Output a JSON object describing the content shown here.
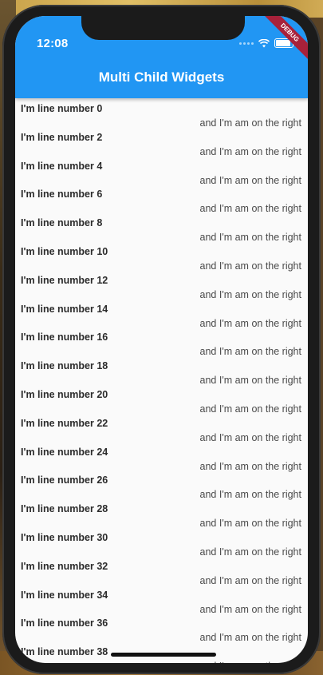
{
  "status_bar": {
    "time": "12:08"
  },
  "banner": {
    "label": "DEBUG"
  },
  "app_bar": {
    "title": "Multi Child Widgets"
  },
  "list": {
    "rows": [
      {
        "left": "I'm line number 0",
        "right": "and I'm am on the right"
      },
      {
        "left": "I'm line number 2",
        "right": "and I'm am on the right"
      },
      {
        "left": "I'm line number 4",
        "right": "and I'm am on the right"
      },
      {
        "left": "I'm line number 6",
        "right": "and I'm am on the right"
      },
      {
        "left": "I'm line number 8",
        "right": "and I'm am on the right"
      },
      {
        "left": "I'm line number 10",
        "right": "and I'm am on the right"
      },
      {
        "left": "I'm line number 12",
        "right": "and I'm am on the right"
      },
      {
        "left": "I'm line number 14",
        "right": "and I'm am on the right"
      },
      {
        "left": "I'm line number 16",
        "right": "and I'm am on the right"
      },
      {
        "left": "I'm line number 18",
        "right": "and I'm am on the right"
      },
      {
        "left": "I'm line number 20",
        "right": "and I'm am on the right"
      },
      {
        "left": "I'm line number 22",
        "right": "and I'm am on the right"
      },
      {
        "left": "I'm line number 24",
        "right": "and I'm am on the right"
      },
      {
        "left": "I'm line number 26",
        "right": "and I'm am on the right"
      },
      {
        "left": "I'm line number 28",
        "right": "and I'm am on the right"
      },
      {
        "left": "I'm line number 30",
        "right": "and I'm am on the right"
      },
      {
        "left": "I'm line number 32",
        "right": "and I'm am on the right"
      },
      {
        "left": "I'm line number 34",
        "right": "and I'm am on the right"
      },
      {
        "left": "I'm line number 36",
        "right": "and I'm am on the right"
      },
      {
        "left": "I'm line number 38",
        "right": "and I'm am on the right"
      }
    ]
  },
  "colors": {
    "app_bar": "#2196f3",
    "banner": "#a8213a",
    "background": "#fafafa"
  }
}
